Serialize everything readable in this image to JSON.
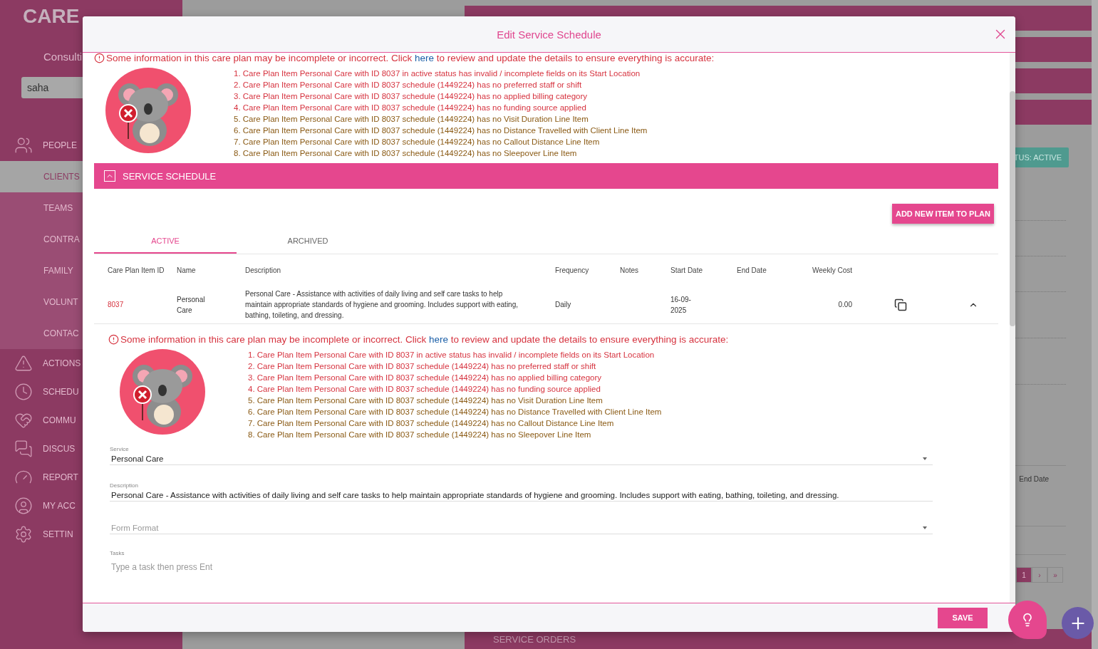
{
  "background": {
    "logo": "CARE",
    "org": "Consulti",
    "search_value": "saha",
    "nav": [
      {
        "label": "PEOPLE",
        "children": [
          {
            "label": "CLIENTS",
            "selected": true
          },
          {
            "label": "TEAMS",
            "selected": false
          },
          {
            "label": "CONTRA",
            "selected": false
          },
          {
            "label": "FAMILY",
            "selected": false
          },
          {
            "label": "VOLUNT",
            "selected": false
          },
          {
            "label": "CONTAC",
            "selected": false
          }
        ]
      },
      {
        "label": "ACTIONS"
      },
      {
        "label": "SCHEDU"
      },
      {
        "label": "COMMU"
      },
      {
        "label": "DISCUS"
      },
      {
        "label": "REPORT"
      },
      {
        "label": "MY ACC"
      },
      {
        "label": "SETTIN"
      }
    ],
    "status_badge": "TUS: ACTIVE",
    "column_header": "End Date",
    "pagination": [
      {
        "label": "1",
        "selected": true
      },
      {
        "label": "›",
        "selected": false
      },
      {
        "label": "»",
        "selected": false
      }
    ],
    "bottom_section": "SERVICE ORDERS"
  },
  "modal": {
    "title": "Edit Service Schedule",
    "warnings": [
      {
        "before": "Some information in this care plan may be incomplete or incorrect. Click ",
        "link": "here",
        "after": " to review and update the details to ensure everything is accurate:",
        "items": [
          {
            "text": "1. Care Plan Item Personal Care with ID 8037 in active status has invalid / incomplete fields on its Start Location",
            "color": "#d6333f"
          },
          {
            "text": "2. Care Plan Item Personal Care with ID 8037 schedule (1449224) has no preferred staff or shift",
            "color": "#d6333f"
          },
          {
            "text": "3. Care Plan Item Personal Care with ID 8037 schedule (1449224) has no applied billing category",
            "color": "#d6333f"
          },
          {
            "text": "4. Care Plan Item Personal Care with ID 8037 schedule (1449224) has no funding source applied",
            "color": "#d6333f"
          },
          {
            "text": "5. Care Plan Item Personal Care with ID 8037 schedule (1449224) has no Visit Duration Line Item",
            "color": "#8a5a14"
          },
          {
            "text": "6. Care Plan Item Personal Care with ID 8037 schedule (1449224) has no Distance Travelled with Client Line Item",
            "color": "#8a5a14"
          },
          {
            "text": "7. Care Plan Item Personal Care with ID 8037 schedule (1449224) has no Callout Distance Line Item",
            "color": "#8a5a14"
          },
          {
            "text": "8. Care Plan Item Personal Care with ID 8037 schedule (1449224) has no Sleepover Line Item",
            "color": "#8a5a14"
          }
        ]
      },
      {
        "before": "Some information in this care plan may be incomplete or incorrect. Click ",
        "link": "here",
        "after": " to review and update the details to ensure everything is accurate:",
        "items": [
          {
            "text": "1. Care Plan Item Personal Care with ID 8037 in active status has invalid / incomplete fields on its Start Location",
            "color": "#d6333f"
          },
          {
            "text": "2. Care Plan Item Personal Care with ID 8037 schedule (1449224) has no preferred staff or shift",
            "color": "#d6333f"
          },
          {
            "text": "3. Care Plan Item Personal Care with ID 8037 schedule (1449224) has no applied billing category",
            "color": "#d6333f"
          },
          {
            "text": "4. Care Plan Item Personal Care with ID 8037 schedule (1449224) has no funding source applied",
            "color": "#d6333f"
          },
          {
            "text": "5. Care Plan Item Personal Care with ID 8037 schedule (1449224) has no Visit Duration Line Item",
            "color": "#8a5a14"
          },
          {
            "text": "6. Care Plan Item Personal Care with ID 8037 schedule (1449224) has no Distance Travelled with Client Line Item",
            "color": "#8a5a14"
          },
          {
            "text": "7. Care Plan Item Personal Care with ID 8037 schedule (1449224) has no Callout Distance Line Item",
            "color": "#8a5a14"
          },
          {
            "text": "8. Care Plan Item Personal Care with ID 8037 schedule (1449224) has no Sleepover Line Item",
            "color": "#8a5a14"
          }
        ]
      }
    ],
    "section": {
      "title": "SERVICE SCHEDULE",
      "expanded": true
    },
    "add_button": "ADD NEW ITEM TO PLAN",
    "tabs": [
      {
        "label": "ACTIVE",
        "selected": true
      },
      {
        "label": "ARCHIVED",
        "selected": false
      }
    ],
    "columns": [
      "Care Plan Item ID",
      "Name",
      "Description",
      "Frequency",
      "Notes",
      "Start Date",
      "End Date",
      "Weekly Cost"
    ],
    "rows": [
      {
        "id": "8037",
        "name": "Personal Care",
        "description": "Personal Care - Assistance with activities of daily living and self care tasks to help maintain appropriate standards of hygiene and grooming. Includes support with eating, bathing, toileting, and dressing.",
        "frequency": "Daily",
        "start_date": "16-09-2025",
        "weekly_cost": "0.00",
        "expanded": true
      }
    ],
    "fields": [
      {
        "kind": "select",
        "label": "Service",
        "value": "Personal Care"
      },
      {
        "kind": "text",
        "label": "Description",
        "value": "Personal Care - Assistance with activities of daily living and self care tasks to help maintain appropriate standards of hygiene and grooming. Includes support with eating, bathing, toileting, and dressing."
      },
      {
        "kind": "select",
        "placeholder": "Form Format"
      },
      {
        "kind": "tags",
        "label": "Tasks",
        "placeholder": "Type a task then press Ent"
      }
    ],
    "save_button": "SAVE"
  }
}
